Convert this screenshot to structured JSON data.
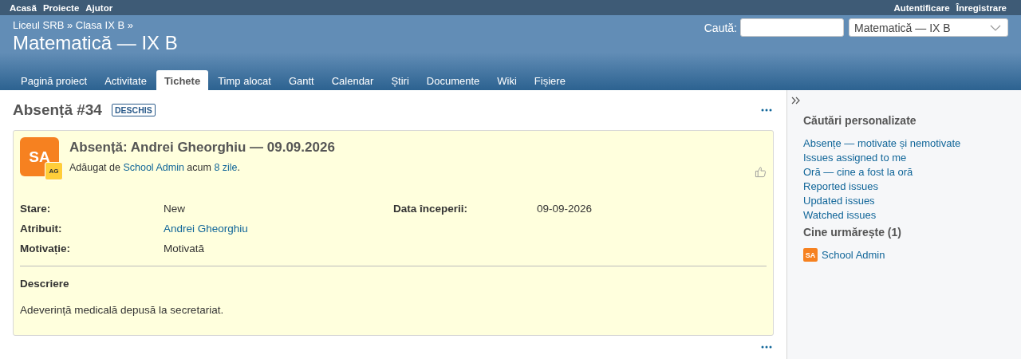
{
  "top_menu": {
    "left": [
      "Acasă",
      "Proiecte",
      "Ajutor"
    ],
    "right": [
      "Autentificare",
      "Înregistrare"
    ]
  },
  "header": {
    "breadcrumb": "Liceul SRB » Clasa IX B »",
    "title": "Matematică — IX B",
    "search_label": "Caută:",
    "project_select": "Matematică — IX B"
  },
  "tabs": [
    {
      "label": "Pagină proiect",
      "selected": false
    },
    {
      "label": "Activitate",
      "selected": false
    },
    {
      "label": "Tichete",
      "selected": true
    },
    {
      "label": "Timp alocat",
      "selected": false
    },
    {
      "label": "Gantt",
      "selected": false
    },
    {
      "label": "Calendar",
      "selected": false
    },
    {
      "label": "Știri",
      "selected": false
    },
    {
      "label": "Documente",
      "selected": false
    },
    {
      "label": "Wiki",
      "selected": false
    },
    {
      "label": "Fișiere",
      "selected": false
    }
  ],
  "issue": {
    "heading": "Absență #34",
    "status_badge": "DESCHIS",
    "avatar": "SA",
    "avatar_badge": "AG",
    "subject": "Absență: Andrei Gheorghiu — 09.09.2026",
    "added": {
      "prefix": "Adăugat de",
      "author": "School Admin",
      "middle": "acum",
      "age": "8 zile",
      "suffix": "."
    },
    "attributes_left": [
      {
        "label": "Stare:",
        "value": "New",
        "kind": "text"
      },
      {
        "label": "Atribuit:",
        "value": "Andrei Gheorghiu",
        "kind": "link"
      },
      {
        "label": "Motivație:",
        "value": "Motivată",
        "kind": "text"
      }
    ],
    "attributes_right": [
      {
        "label": "Data începerii:",
        "value": "09-09-2026",
        "kind": "text"
      }
    ],
    "description_title": "Descriere",
    "description": "Adeverință medicală depusă la secretariat."
  },
  "sidebar": {
    "queries_title": "Căutări personalizate",
    "queries": [
      "Absențe — motivate și nemotivate",
      "Issues assigned to me",
      "Oră — cine a fost la oră",
      "Reported issues",
      "Updated issues",
      "Watched issues"
    ],
    "watchers_title": "Cine urmărește (1)",
    "watchers": [
      {
        "avatar": "SA",
        "name": "School Admin"
      }
    ]
  }
}
